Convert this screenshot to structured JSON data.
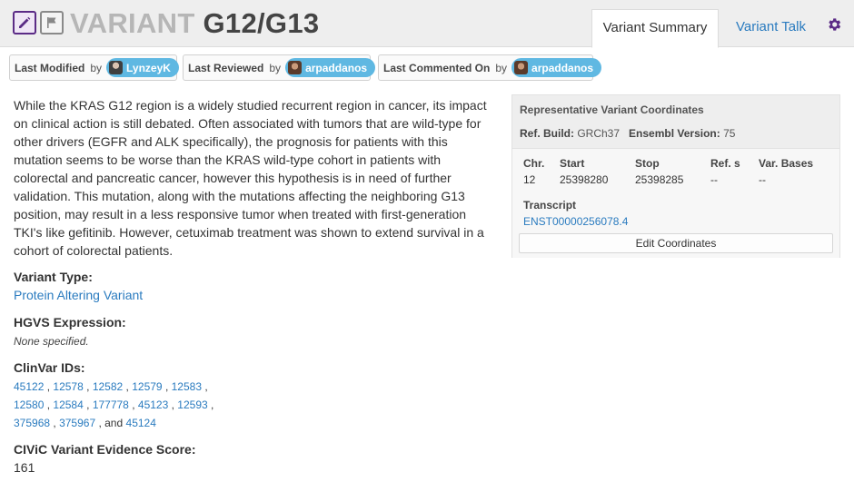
{
  "header": {
    "title_kind": "VARIANT",
    "title_name": "G12/G13",
    "tabs": [
      {
        "label": "Variant Summary",
        "active": true
      },
      {
        "label": "Variant Talk",
        "active": false
      }
    ],
    "icons": {
      "edit": "pencil-icon",
      "flag": "flag-icon",
      "settings": "gear-icon"
    },
    "accent_color": "#5b2b86",
    "link_color": "#2a7bbf",
    "pill_color": "#5fb8e2"
  },
  "meta": {
    "last_modified": {
      "label": "Last Modified",
      "by": "by",
      "user": "LynzeyK"
    },
    "last_reviewed": {
      "label": "Last Reviewed",
      "by": "by",
      "user": "arpaddanos"
    },
    "last_commented": {
      "label": "Last Commented On",
      "by": "by",
      "user": "arpaddanos"
    }
  },
  "summary": {
    "description": "While the KRAS G12 region is a widely studied recurrent region in cancer, its impact on clinical action is still debated. Often associated with tumors that are wild-type for other drivers (EGFR and ALK specifically), the prognosis for patients with this mutation seems to be worse than the KRAS wild-type cohort in patients with colorectal and pancreatic cancer, however this hypothesis is in need of further validation. This mutation, along with the mutations affecting the neighboring G13 position, may result in a less responsive tumor when treated with first-generation TKI's like gefitinib. However, cetuximab treatment was shown to extend survival in a cohort of colorectal patients.",
    "variant_type_label": "Variant Type:",
    "variant_type_value": "Protein Altering Variant",
    "hgvs_label": "HGVS Expression:",
    "hgvs_value": "None specified.",
    "clinvar_label": "ClinVar IDs:",
    "clinvar_ids": [
      "45122",
      "12578",
      "12582",
      "12579",
      "12583",
      "12580",
      "12584",
      "177778",
      "45123",
      "12593",
      "375968",
      "375967",
      "45124"
    ],
    "clinvar_sep": ",",
    "clinvar_and": ", and",
    "score_label": "CIViC Variant Evidence Score:",
    "score_value": "161"
  },
  "coordinates": {
    "title": "Representative Variant Coordinates",
    "ref_build_label": "Ref. Build:",
    "ref_build_value": "GRCh37",
    "ensembl_label": "Ensembl Version:",
    "ensembl_value": "75",
    "columns": [
      {
        "header": "Chr.",
        "value": "12"
      },
      {
        "header": "Start",
        "value": "25398280"
      },
      {
        "header": "Stop",
        "value": "25398285"
      },
      {
        "header": "Ref. s",
        "value": "--"
      },
      {
        "header": "Var. Bases",
        "value": "--"
      }
    ],
    "transcript_label": "Transcript",
    "transcript_value": "ENST00000256078.4",
    "edit_button": "Edit Coordinates"
  }
}
